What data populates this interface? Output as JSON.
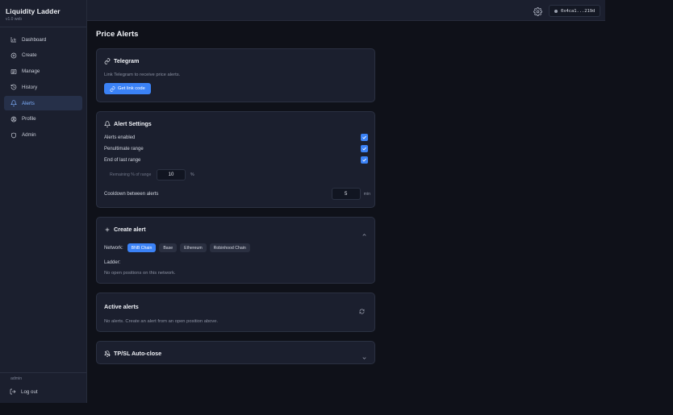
{
  "app": {
    "title": "Liquidity Ladder",
    "version": "v1.0 web"
  },
  "sidebar": {
    "items": [
      {
        "label": "Dashboard",
        "icon": "chart-icon"
      },
      {
        "label": "Create",
        "icon": "plus-circle-icon"
      },
      {
        "label": "Manage",
        "icon": "list-icon"
      },
      {
        "label": "History",
        "icon": "history-icon"
      },
      {
        "label": "Alerts",
        "icon": "bell-icon",
        "active": true
      },
      {
        "label": "Profile",
        "icon": "user-circle-icon"
      },
      {
        "label": "Admin",
        "icon": "shield-icon"
      }
    ],
    "user": "admin",
    "logout_label": "Log out"
  },
  "topbar": {
    "wallet": "0x4ca1...219d"
  },
  "page": {
    "title": "Price Alerts"
  },
  "telegram": {
    "title": "Telegram",
    "description": "Link Telegram to receive price alerts.",
    "button_label": "Get link code"
  },
  "settings": {
    "title": "Alert Settings",
    "alerts_enabled": "Alerts enabled",
    "penultimate": "Penultimate range",
    "end_of_last": "End of last range",
    "remaining_label": "Remaining % of range",
    "remaining_value": "10",
    "remaining_unit": "%",
    "cooldown_label": "Cooldown between alerts",
    "cooldown_value": "5",
    "cooldown_unit": "min"
  },
  "create": {
    "title": "Create alert",
    "network_label": "Network:",
    "networks": [
      "BNB Chain",
      "Base",
      "Ethereum",
      "Robinhood Chain"
    ],
    "ladder_label": "Ladder:",
    "empty": "No open positions on this network."
  },
  "active": {
    "title": "Active alerts",
    "empty": "No alerts. Create an alert from an open position above."
  },
  "tpsl": {
    "title": "TP/SL Auto-close"
  },
  "colors": {
    "accent": "#3b82f6",
    "background": "#0f1119",
    "panel": "#1b1f2e"
  }
}
